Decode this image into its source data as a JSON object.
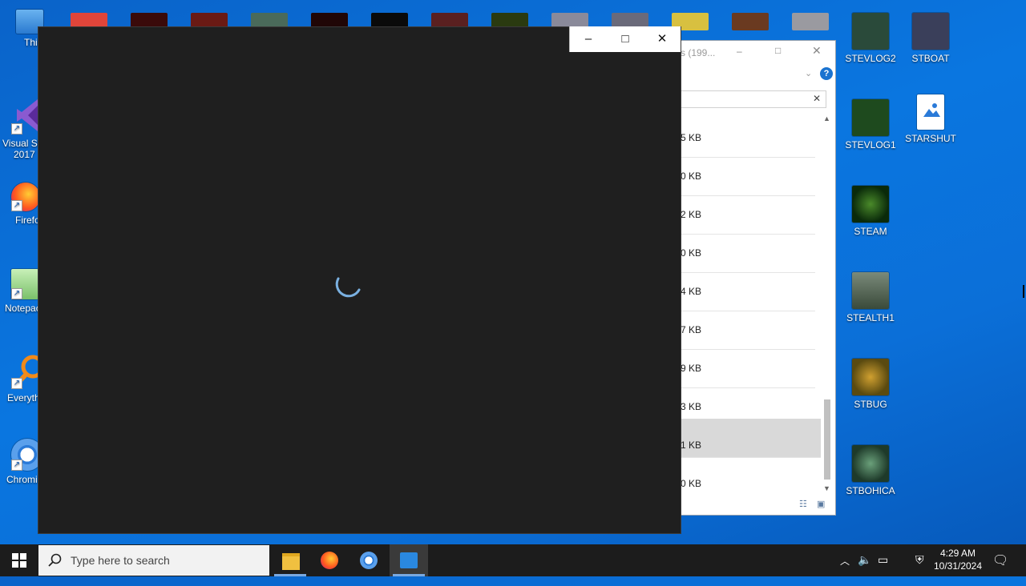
{
  "desktop": {
    "left_icons": [
      {
        "label": "This P",
        "icon": "this-pc-icon"
      },
      {
        "label": "Visual St",
        "label2": "2017",
        "icon": "visual-studio-icon"
      },
      {
        "label": "Firefo",
        "icon": "firefox-icon"
      },
      {
        "label": "Notepac",
        "icon": "notepad-icon"
      },
      {
        "label": "Everyth",
        "icon": "everything-search-icon"
      },
      {
        "label": "Chromi",
        "icon": "chromium-icon"
      }
    ],
    "right_icons": [
      {
        "label": "STEVLOG2",
        "color": "#2a4a3a"
      },
      {
        "label": "STBOAT",
        "color": "#3a3f5a"
      },
      {
        "label": "STEVLOG1",
        "color": "#1e4a1e"
      },
      {
        "label": "STARSHUT",
        "color": "#ffffff"
      },
      {
        "label": "STEAM",
        "color": "#0a2a0a"
      },
      {
        "label": "STEALTH1",
        "color": "#4d5a4d"
      },
      {
        "label": "STBUG",
        "color": "#6a5a20"
      },
      {
        "label": "STBOHICA",
        "color": "#2e5a3a"
      }
    ]
  },
  "explorer": {
    "title_fragment": "s (199...",
    "sizes": [
      "5 KB",
      "0 KB",
      "2 KB",
      "0 KB",
      "4 KB",
      "7 KB",
      "9 KB",
      "3 KB",
      "1 KB",
      "0 KB"
    ],
    "selected_index": 8
  },
  "app_window": {
    "minimize": "–",
    "maximize": "□",
    "close": "✕",
    "state": "loading"
  },
  "taskbar": {
    "search_placeholder": "Type here to search",
    "time": "4:29 AM",
    "date": "10/31/2024"
  }
}
